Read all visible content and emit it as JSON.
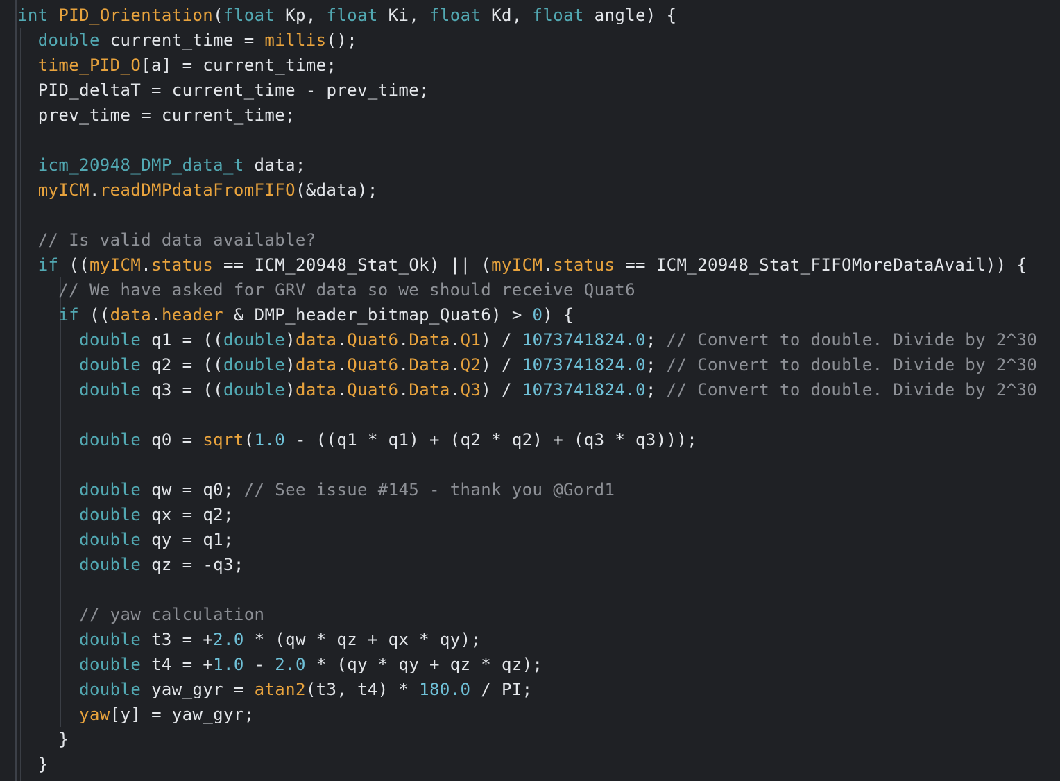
{
  "editor": {
    "lines": [
      [
        [
          "kw",
          "int"
        ],
        [
          "pl",
          " "
        ],
        [
          "fn",
          "PID_Orientation"
        ],
        [
          "pl",
          "("
        ],
        [
          "kw",
          "float"
        ],
        [
          "pl",
          " Kp, "
        ],
        [
          "kw",
          "float"
        ],
        [
          "pl",
          " Ki, "
        ],
        [
          "kw",
          "float"
        ],
        [
          "pl",
          " Kd, "
        ],
        [
          "kw",
          "float"
        ],
        [
          "pl",
          " angle) {"
        ]
      ],
      [
        [
          "pl",
          "  "
        ],
        [
          "kw",
          "double"
        ],
        [
          "pl",
          " current_time = "
        ],
        [
          "fn",
          "millis"
        ],
        [
          "pl",
          "();"
        ]
      ],
      [
        [
          "pl",
          "  "
        ],
        [
          "var",
          "time_PID_O"
        ],
        [
          "pl",
          "[a] = current_time;"
        ]
      ],
      [
        [
          "pl",
          "  PID_deltaT = current_time - prev_time;"
        ]
      ],
      [
        [
          "pl",
          "  prev_time = current_time;"
        ]
      ],
      [
        [
          "pl",
          ""
        ]
      ],
      [
        [
          "pl",
          "  "
        ],
        [
          "kw",
          "icm_20948_DMP_data_t"
        ],
        [
          "pl",
          " data;"
        ]
      ],
      [
        [
          "pl",
          "  "
        ],
        [
          "var",
          "myICM"
        ],
        [
          "pl",
          "."
        ],
        [
          "fn",
          "readDMPdataFromFIFO"
        ],
        [
          "pl",
          "(&data);"
        ]
      ],
      [
        [
          "pl",
          ""
        ]
      ],
      [
        [
          "pl",
          "  "
        ],
        [
          "cm",
          "// Is valid data available?"
        ]
      ],
      [
        [
          "pl",
          "  "
        ],
        [
          "kw",
          "if"
        ],
        [
          "pl",
          " (("
        ],
        [
          "var",
          "myICM"
        ],
        [
          "pl",
          "."
        ],
        [
          "var",
          "status"
        ],
        [
          "pl",
          " == ICM_20948_Stat_Ok) || ("
        ],
        [
          "var",
          "myICM"
        ],
        [
          "pl",
          "."
        ],
        [
          "var",
          "status"
        ],
        [
          "pl",
          " == ICM_20948_Stat_FIFOMoreDataAvail)) {"
        ]
      ],
      [
        [
          "pl",
          "    "
        ],
        [
          "cm",
          "// We have asked for GRV data so we should receive Quat6"
        ]
      ],
      [
        [
          "pl",
          "    "
        ],
        [
          "kw",
          "if"
        ],
        [
          "pl",
          " (("
        ],
        [
          "var",
          "data"
        ],
        [
          "pl",
          "."
        ],
        [
          "var",
          "header"
        ],
        [
          "pl",
          " & DMP_header_bitmap_Quat6) > "
        ],
        [
          "num",
          "0"
        ],
        [
          "pl",
          ") {"
        ]
      ],
      [
        [
          "pl",
          "      "
        ],
        [
          "kw",
          "double"
        ],
        [
          "pl",
          " q1 = (("
        ],
        [
          "kw",
          "double"
        ],
        [
          "pl",
          ")"
        ],
        [
          "var",
          "data"
        ],
        [
          "pl",
          "."
        ],
        [
          "var",
          "Quat6"
        ],
        [
          "pl",
          "."
        ],
        [
          "var",
          "Data"
        ],
        [
          "pl",
          "."
        ],
        [
          "var",
          "Q1"
        ],
        [
          "pl",
          ") / "
        ],
        [
          "num",
          "1073741824.0"
        ],
        [
          "pl",
          "; "
        ],
        [
          "cm",
          "// Convert to double. Divide by 2^30"
        ]
      ],
      [
        [
          "pl",
          "      "
        ],
        [
          "kw",
          "double"
        ],
        [
          "pl",
          " q2 = (("
        ],
        [
          "kw",
          "double"
        ],
        [
          "pl",
          ")"
        ],
        [
          "var",
          "data"
        ],
        [
          "pl",
          "."
        ],
        [
          "var",
          "Quat6"
        ],
        [
          "pl",
          "."
        ],
        [
          "var",
          "Data"
        ],
        [
          "pl",
          "."
        ],
        [
          "var",
          "Q2"
        ],
        [
          "pl",
          ") / "
        ],
        [
          "num",
          "1073741824.0"
        ],
        [
          "pl",
          "; "
        ],
        [
          "cm",
          "// Convert to double. Divide by 2^30"
        ]
      ],
      [
        [
          "pl",
          "      "
        ],
        [
          "kw",
          "double"
        ],
        [
          "pl",
          " q3 = (("
        ],
        [
          "kw",
          "double"
        ],
        [
          "pl",
          ")"
        ],
        [
          "var",
          "data"
        ],
        [
          "pl",
          "."
        ],
        [
          "var",
          "Quat6"
        ],
        [
          "pl",
          "."
        ],
        [
          "var",
          "Data"
        ],
        [
          "pl",
          "."
        ],
        [
          "var",
          "Q3"
        ],
        [
          "pl",
          ") / "
        ],
        [
          "num",
          "1073741824.0"
        ],
        [
          "pl",
          "; "
        ],
        [
          "cm",
          "// Convert to double. Divide by 2^30"
        ]
      ],
      [
        [
          "pl",
          ""
        ]
      ],
      [
        [
          "pl",
          "      "
        ],
        [
          "kw",
          "double"
        ],
        [
          "pl",
          " q0 = "
        ],
        [
          "fn",
          "sqrt"
        ],
        [
          "pl",
          "("
        ],
        [
          "num",
          "1.0"
        ],
        [
          "pl",
          " - ((q1 * q1) + (q2 * q2) + (q3 * q3)));"
        ]
      ],
      [
        [
          "pl",
          ""
        ]
      ],
      [
        [
          "pl",
          "      "
        ],
        [
          "kw",
          "double"
        ],
        [
          "pl",
          " qw = q0; "
        ],
        [
          "cm",
          "// See issue #145 - thank you @Gord1"
        ]
      ],
      [
        [
          "pl",
          "      "
        ],
        [
          "kw",
          "double"
        ],
        [
          "pl",
          " qx = q2;"
        ]
      ],
      [
        [
          "pl",
          "      "
        ],
        [
          "kw",
          "double"
        ],
        [
          "pl",
          " qy = q1;"
        ]
      ],
      [
        [
          "pl",
          "      "
        ],
        [
          "kw",
          "double"
        ],
        [
          "pl",
          " qz = -q3;"
        ]
      ],
      [
        [
          "pl",
          ""
        ]
      ],
      [
        [
          "pl",
          "      "
        ],
        [
          "cm",
          "// yaw calculation"
        ]
      ],
      [
        [
          "pl",
          "      "
        ],
        [
          "kw",
          "double"
        ],
        [
          "pl",
          " t3 = +"
        ],
        [
          "num",
          "2.0"
        ],
        [
          "pl",
          " * (qw * qz + qx * qy);"
        ]
      ],
      [
        [
          "pl",
          "      "
        ],
        [
          "kw",
          "double"
        ],
        [
          "pl",
          " t4 = +"
        ],
        [
          "num",
          "1.0"
        ],
        [
          "pl",
          " - "
        ],
        [
          "num",
          "2.0"
        ],
        [
          "pl",
          " * (qy * qy + qz * qz);"
        ]
      ],
      [
        [
          "pl",
          "      "
        ],
        [
          "kw",
          "double"
        ],
        [
          "pl",
          " yaw_gyr = "
        ],
        [
          "fn",
          "atan2"
        ],
        [
          "pl",
          "(t3, t4) * "
        ],
        [
          "num",
          "180.0"
        ],
        [
          "pl",
          " / PI;"
        ]
      ],
      [
        [
          "pl",
          "      "
        ],
        [
          "var",
          "yaw"
        ],
        [
          "pl",
          "[y] = yaw_gyr;"
        ]
      ],
      [
        [
          "pl",
          "    }"
        ]
      ],
      [
        [
          "pl",
          "  }"
        ]
      ]
    ]
  },
  "colors": {
    "background": "#1f2125",
    "keyword": "#52a9b3",
    "function": "#e8a33d",
    "number": "#6fc1d8",
    "comment": "#8d9096",
    "text": "#e3e6ea"
  }
}
